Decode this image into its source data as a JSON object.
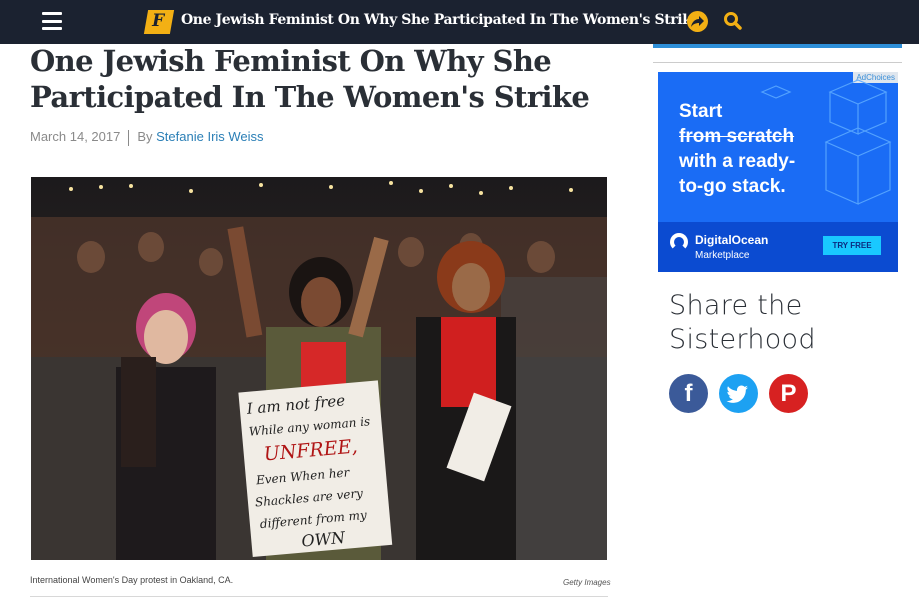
{
  "topbar": {
    "logo_letter": "F",
    "title": "One Jewish Feminist On Why She Participated In The Women's Strike",
    "icons": [
      "menu-icon",
      "share-arrow-icon",
      "search-icon"
    ]
  },
  "article": {
    "headline": "One Jewish Feminist On Why She Participated In The Women's Strike",
    "date": "March 14, 2017",
    "by_label": "By",
    "author": "Stefanie Iris Weiss",
    "caption": "International Women's Day protest in Oakland, CA.",
    "credit": "Getty Images",
    "sign_text": [
      "I am not free",
      "While any woman is",
      "UNFREE,",
      "Even When her",
      "Shackles are very",
      "different from my",
      "OWN"
    ]
  },
  "ad": {
    "adchoices": "AdChoices",
    "line1": "Start",
    "line2": "from scratch",
    "line3": "with a ready-",
    "line4": "to-go stack.",
    "brand": "DigitalOcean",
    "brand_sub": "Marketplace",
    "cta": "TRY FREE"
  },
  "sidebar": {
    "share_title_line1": "Share the",
    "share_title_line2": "Sisterhood",
    "social": [
      {
        "name": "facebook",
        "glyph": "f"
      },
      {
        "name": "twitter",
        "glyph": "t"
      },
      {
        "name": "pinterest",
        "glyph": "P"
      }
    ]
  },
  "colors": {
    "topbar": "#1b2230",
    "brand_accent": "#f3b014",
    "link": "#2b7fb6",
    "facebook": "#3b5a99",
    "twitter": "#1da1f2",
    "pinterest": "#d72121",
    "ad_blue": "#1a6cf5"
  }
}
